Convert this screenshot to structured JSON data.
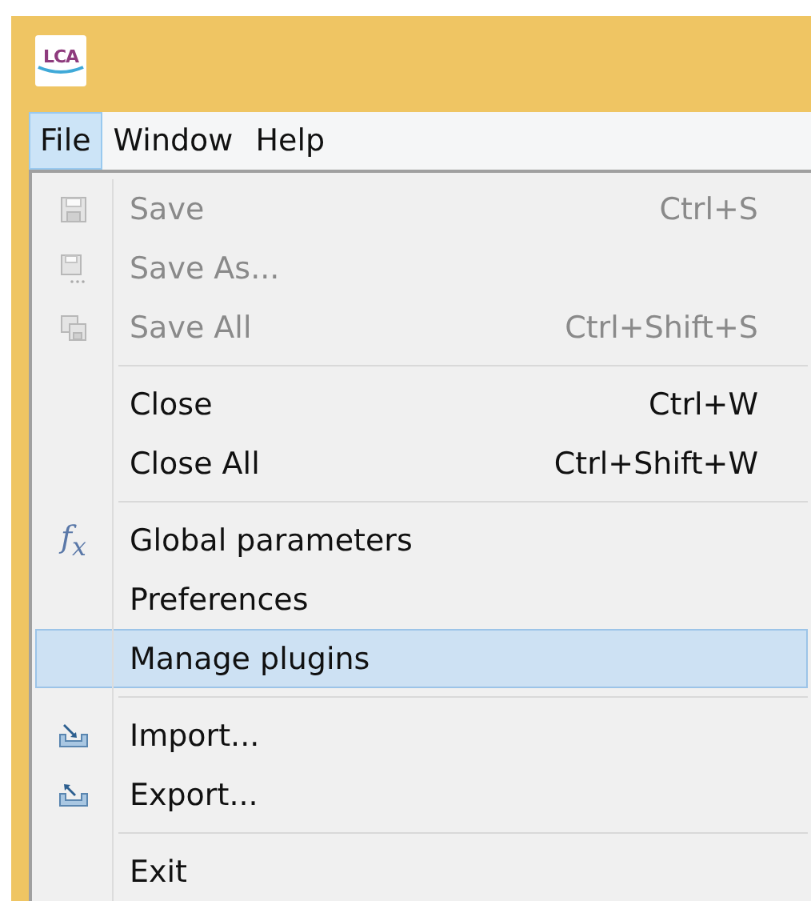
{
  "app_logo": {
    "text": "LCA"
  },
  "menu_bar": [
    {
      "label": "File",
      "selected": true
    },
    {
      "label": "Window",
      "selected": false
    },
    {
      "label": "Help",
      "selected": false
    }
  ],
  "menu": [
    {
      "kind": "save",
      "label": "Save",
      "shortcut": "Ctrl+S",
      "disabled": true,
      "selected": false
    },
    {
      "kind": "saveas",
      "label": "Save As...",
      "disabled": true,
      "selected": false
    },
    {
      "kind": "saveall",
      "label": "Save All",
      "shortcut": "Ctrl+Shift+S",
      "disabled": true,
      "selected": false
    },
    {
      "kind": "separator"
    },
    {
      "kind": "plain",
      "label": "Close",
      "shortcut": "Ctrl+W",
      "disabled": false,
      "selected": false
    },
    {
      "kind": "plain",
      "label": "Close All",
      "shortcut": "Ctrl+Shift+W",
      "disabled": false,
      "selected": false
    },
    {
      "kind": "separator"
    },
    {
      "kind": "formula",
      "icon_text": "f$_{x}$",
      "label": "Global parameters",
      "disabled": false,
      "selected": false
    },
    {
      "kind": "plain",
      "label": "Preferences",
      "disabled": false,
      "selected": false
    },
    {
      "kind": "plain",
      "label": "Manage plugins",
      "disabled": false,
      "selected": true
    },
    {
      "kind": "separator"
    },
    {
      "kind": "import",
      "label": "Import...",
      "disabled": false,
      "selected": false
    },
    {
      "kind": "export",
      "label": "Export...",
      "disabled": false,
      "selected": false
    },
    {
      "kind": "separator"
    },
    {
      "kind": "plain",
      "label": "Exit",
      "disabled": false,
      "selected": false
    }
  ]
}
